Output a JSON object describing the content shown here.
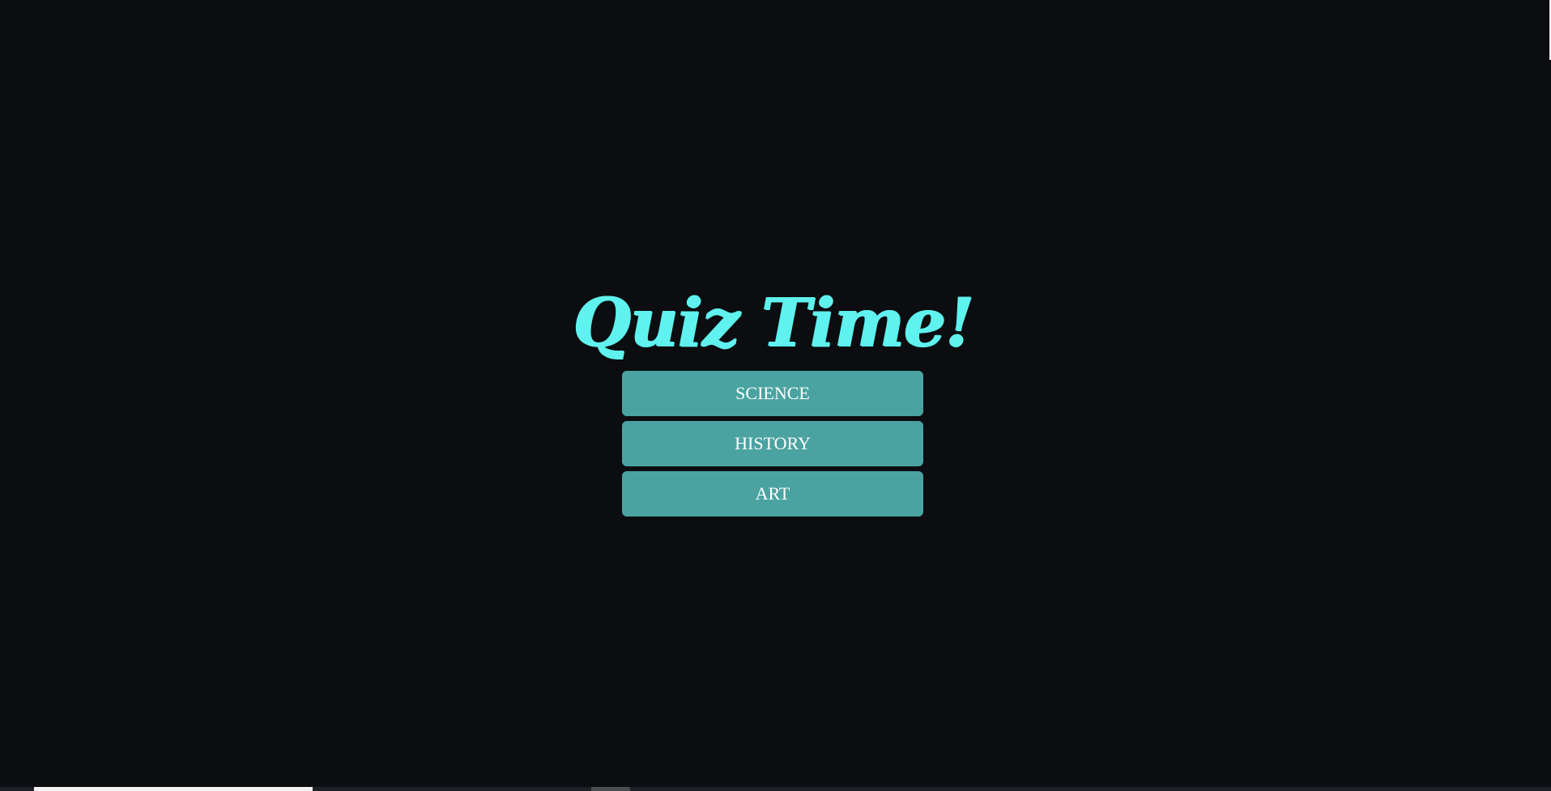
{
  "app": {
    "title": "Quiz Time!"
  },
  "menu": {
    "items": [
      {
        "label": "SCIENCE"
      },
      {
        "label": "HISTORY"
      },
      {
        "label": "ART"
      }
    ]
  },
  "colors": {
    "background": "#0b0d10",
    "title": "#5ff2ee",
    "button_bg": "#4aa3a1",
    "button_text": "#ffffff"
  }
}
